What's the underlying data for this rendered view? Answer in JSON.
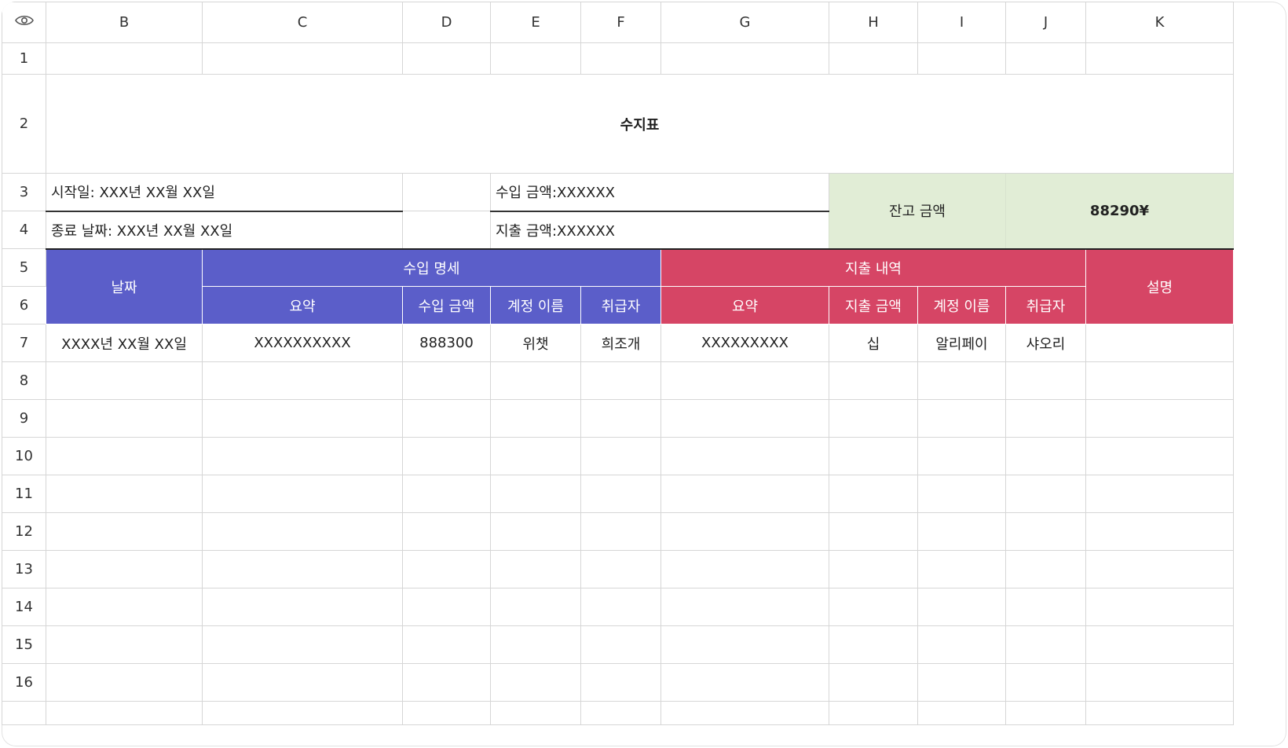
{
  "columns": [
    "B",
    "C",
    "D",
    "E",
    "F",
    "G",
    "H",
    "I",
    "J",
    "K"
  ],
  "rows": [
    "1",
    "2",
    "3",
    "4",
    "5",
    "6",
    "7",
    "8",
    "9",
    "10",
    "11",
    "12",
    "13",
    "14",
    "15",
    "16"
  ],
  "title": "수지표",
  "info": {
    "start_date": "시작일: XXX년 XX월 XX일",
    "end_date": "종료 날짜: XXX년 XX월 XX일",
    "income_total": "수입 금액:XXXXXX",
    "expense_total": "지출 금액:XXXXXX"
  },
  "balance": {
    "label": "잔고 금액",
    "value": "88290¥"
  },
  "headers": {
    "date": "날짜",
    "income_group": "수입 명세",
    "expense_group": "지출 내역",
    "description": "설명",
    "income_cols": [
      "요약",
      "수입 금액",
      "계정 이름",
      "취급자"
    ],
    "expense_cols": [
      "요약",
      "지출 금액",
      "계정 이름",
      "취급자"
    ]
  },
  "entries": [
    {
      "date": "XXXX년 XX월 XX일",
      "income_summary": "XXXXXXXXXX",
      "income_amount": "888300",
      "income_account": "위챗",
      "income_handler": "희조개",
      "expense_summary": "XXXXXXXXX",
      "expense_amount": "십",
      "expense_account": "알리페이",
      "expense_handler": "샤오리",
      "description": ""
    }
  ],
  "colors": {
    "income": "#5b5ec9",
    "expense": "#d64565",
    "balance_bg": "#e1edd6"
  }
}
